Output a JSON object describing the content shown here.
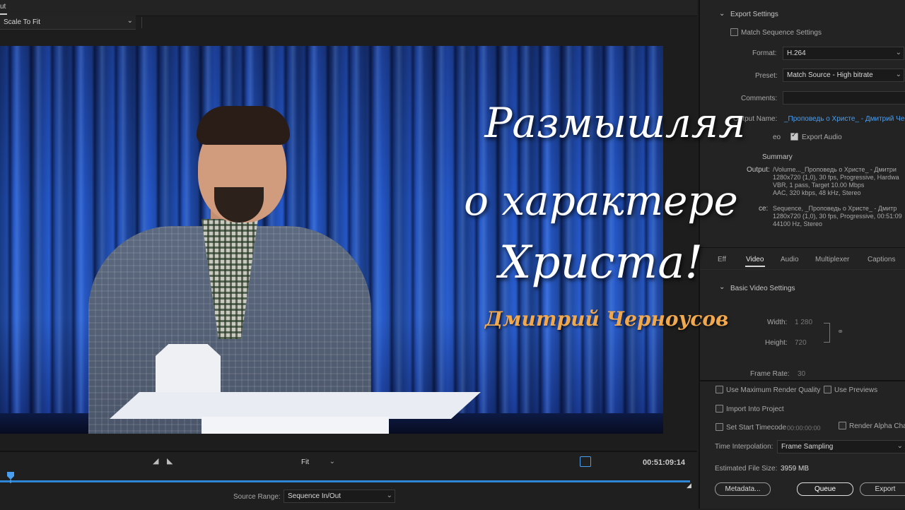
{
  "app": {
    "top_tab": "ut",
    "scale_select": "Scale To Fit"
  },
  "overlay": {
    "title_line1": "Размышляя",
    "title_line2": "о характере",
    "title_line3": "Христа!",
    "author": "Дмитрий Черноусов"
  },
  "export_settings": {
    "section_title": "Export Settings",
    "match_sequence": "Match Sequence Settings",
    "format_label": "Format:",
    "format_value": "H.264",
    "preset_label": "Preset:",
    "preset_value": "Match Source - High bitrate",
    "comments_label": "Comments:",
    "output_name_label": "Output Name:",
    "output_name_value": "_Проповедь о Христе_ - Дмитрий Чер",
    "export_video_fragment": "eo",
    "export_audio": "Export Audio",
    "summary_label": "Summary",
    "output_label": "Output:",
    "output_lines": [
      "/Volume..._Проповедь о Христе_ - Дмитри",
      "1280x720 (1,0), 30 fps, Progressive, Hardwa",
      "VBR, 1 pass, Target 10.00 Mbps",
      "AAC, 320 kbps, 48 kHz, Stereo"
    ],
    "source_label": "ce:",
    "source_lines": [
      "Sequence, _Проповедь о Христе_ - Дмитр",
      "1280x720 (1,0), 30 fps, Progressive, 00:51:09",
      "44100 Hz, Stereo"
    ]
  },
  "tabs": {
    "effects": "Eff",
    "video": "Video",
    "audio": "Audio",
    "multiplexer": "Multiplexer",
    "captions": "Captions"
  },
  "basic_video": {
    "title": "Basic Video Settings",
    "width_label": "Width:",
    "width_value": "1 280",
    "height_label": "Height:",
    "height_value": "720",
    "frame_rate_label": "Frame Rate:",
    "frame_rate_value": "30"
  },
  "render_options": {
    "max_render_quality": "Use Maximum Render Quality",
    "use_previews": "Use Previews",
    "import_into_project": "Import Into Project",
    "set_start_timecode": "Set Start Timecode",
    "start_timecode_value": "00:00:00:00",
    "render_alpha": "Render Alpha Cha",
    "time_interpolation_label": "Time Interpolation:",
    "time_interpolation_value": "Frame Sampling",
    "estimated_size_label": "Estimated File Size:",
    "estimated_size_value": "3959 MB"
  },
  "buttons": {
    "metadata": "Metadata...",
    "queue": "Queue",
    "export": "Export"
  },
  "transport": {
    "fit_value": "Fit",
    "timecode": "00:51:09:14",
    "source_range_label": "Source Range:",
    "source_range_value": "Sequence In/Out"
  },
  "checkbox_state": {
    "match_sequence": false,
    "export_audio": true,
    "max_render_quality": false,
    "use_previews": false,
    "import_into_project": false,
    "set_start_timecode": false,
    "render_alpha": false
  },
  "colors": {
    "accent_blue": "#2f86d6",
    "author_orange": "#f2a94e",
    "panel_bg": "#232323"
  }
}
